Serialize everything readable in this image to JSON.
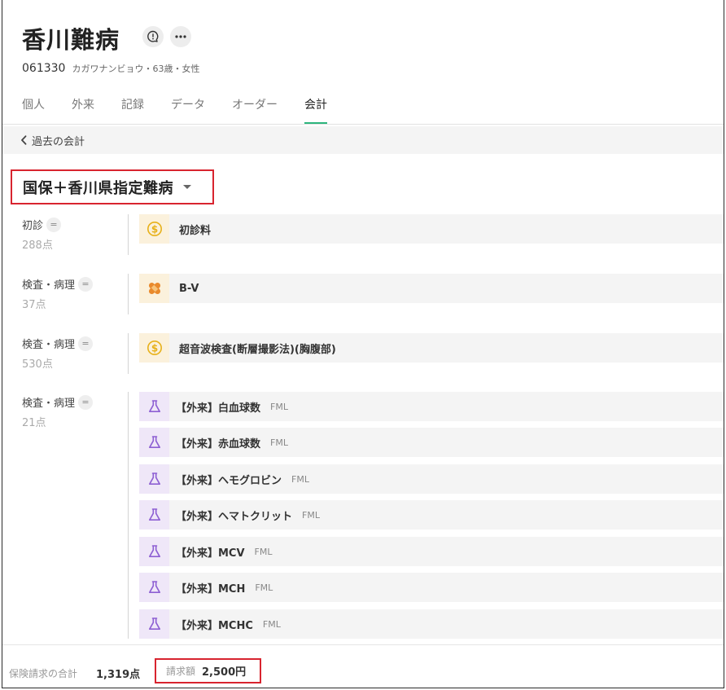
{
  "patient": {
    "name": "香川難病",
    "id": "061330",
    "meta": "カガワナンビョウ・63歳・女性"
  },
  "tabs": [
    {
      "label": "個人"
    },
    {
      "label": "外来"
    },
    {
      "label": "記録"
    },
    {
      "label": "データ"
    },
    {
      "label": "オーダー"
    },
    {
      "label": "会計"
    }
  ],
  "active_tab": "会計",
  "back_link": "過去の会計",
  "insurance": "国保＋香川県指定難病",
  "groups": [
    {
      "category": "初診",
      "points": "288点",
      "items": [
        {
          "name": "初診料",
          "icon": "coin-icon"
        }
      ]
    },
    {
      "category": "検査・病理",
      "points": "37点",
      "items": [
        {
          "name": "B-V",
          "icon": "bandage-icon"
        }
      ]
    },
    {
      "category": "検査・病理",
      "points": "530点",
      "items": [
        {
          "name": "超音波検査(断層撮影法)(胸腹部)",
          "icon": "coin-icon"
        }
      ]
    },
    {
      "category": "検査・病理",
      "points": "21点",
      "items": [
        {
          "name": "【外来】白血球数",
          "tag": "FML",
          "icon": "flask-icon"
        },
        {
          "name": "【外来】赤血球数",
          "tag": "FML",
          "icon": "flask-icon"
        },
        {
          "name": "【外来】ヘモグロビン",
          "tag": "FML",
          "icon": "flask-icon"
        },
        {
          "name": "【外来】ヘマトクリット",
          "tag": "FML",
          "icon": "flask-icon"
        },
        {
          "name": "【外来】MCV",
          "tag": "FML",
          "icon": "flask-icon"
        },
        {
          "name": "【外来】MCH",
          "tag": "FML",
          "icon": "flask-icon"
        },
        {
          "name": "【外来】MCHC",
          "tag": "FML",
          "icon": "flask-icon"
        }
      ]
    }
  ],
  "footer": {
    "insurance_total_label": "保険請求の合計",
    "insurance_total_value": "1,319点",
    "billed_label": "請求額",
    "billed_value": "2,500円"
  },
  "colors": {
    "accent": "#2db57d",
    "highlight": "#d8242f",
    "coin": "#e7b11a",
    "bandage": "#e98a2c",
    "flask": "#8d5fd3"
  }
}
